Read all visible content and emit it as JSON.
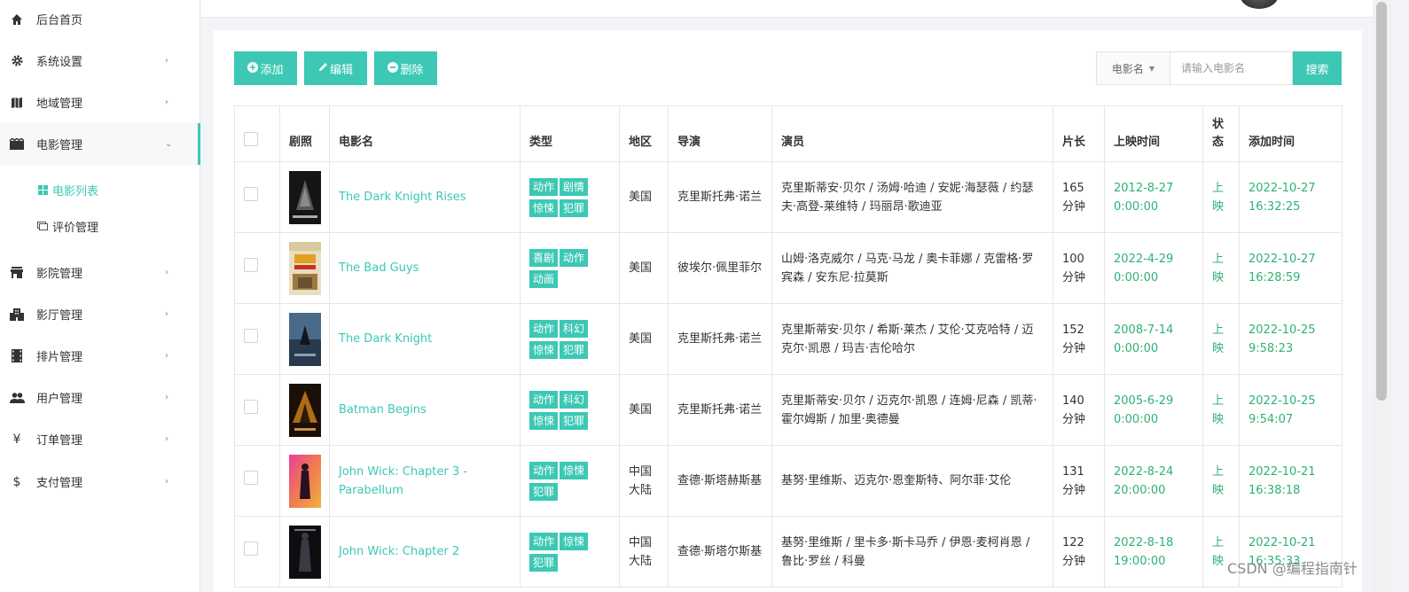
{
  "sidebar": {
    "items": [
      {
        "label": "后台首页",
        "icon": "home-icon"
      },
      {
        "label": "系统设置",
        "icon": "gear-icon"
      },
      {
        "label": "地域管理",
        "icon": "map-icon"
      },
      {
        "label": "电影管理",
        "icon": "film-icon"
      },
      {
        "label": "影院管理",
        "icon": "store-icon"
      },
      {
        "label": "影厅管理",
        "icon": "building-icon"
      },
      {
        "label": "排片管理",
        "icon": "film-strip-icon"
      },
      {
        "label": "用户管理",
        "icon": "users-icon"
      },
      {
        "label": "订单管理",
        "icon": "yen-icon"
      },
      {
        "label": "支付管理",
        "icon": "dollar-icon"
      }
    ],
    "submenu": [
      {
        "label": "电影列表",
        "icon": "grid-icon"
      },
      {
        "label": "评价管理",
        "icon": "comment-icon"
      }
    ]
  },
  "toolbar": {
    "add_label": "添加",
    "edit_label": "编辑",
    "delete_label": "删除"
  },
  "search": {
    "select_label": "电影名",
    "placeholder": "请输入电影名",
    "button_label": "搜索"
  },
  "table": {
    "headers": [
      "剧照",
      "电影名",
      "类型",
      "地区",
      "导演",
      "演员",
      "片长",
      "上映时间",
      "状态",
      "添加时间"
    ],
    "rows": [
      {
        "title": "The Dark Knight Rises",
        "tags": [
          "动作",
          "剧情",
          "惊悚",
          "犯罪"
        ],
        "region": "美国",
        "director": "克里斯托弗·诺兰",
        "cast": "克里斯蒂安·贝尔 / 汤姆·哈迪 / 安妮·海瑟薇 / 约瑟夫·高登-莱维特 / 玛丽昂·歌迪亚",
        "length": "165分钟",
        "release": "2012-8-27 0:00:00",
        "status": "上映",
        "added": "2022-10-27 16:32:25"
      },
      {
        "title": "The Bad Guys",
        "tags": [
          "喜剧",
          "动作",
          "动画"
        ],
        "region": "美国",
        "director": "彼埃尔·佩里菲尔",
        "cast": "山姆·洛克威尔 / 马克·马龙 / 奥卡菲娜 / 克雷格·罗宾森 / 安东尼·拉莫斯",
        "length": "100分钟",
        "release": "2022-4-29 0:00:00",
        "status": "上映",
        "added": "2022-10-27 16:28:59"
      },
      {
        "title": "The Dark Knight",
        "tags": [
          "动作",
          "科幻",
          "惊悚",
          "犯罪"
        ],
        "region": "美国",
        "director": "克里斯托弗·诺兰",
        "cast": "克里斯蒂安·贝尔 / 希斯·莱杰 / 艾伦·艾克哈特 / 迈克尔·凯恩 / 玛吉·吉伦哈尔",
        "length": "152分钟",
        "release": "2008-7-14 0:00:00",
        "status": "上映",
        "added": "2022-10-25 9:58:23"
      },
      {
        "title": "Batman Begins",
        "tags": [
          "动作",
          "科幻",
          "惊悚",
          "犯罪"
        ],
        "region": "美国",
        "director": "克里斯托弗·诺兰",
        "cast": "克里斯蒂安·贝尔 / 迈克尔·凯恩 / 连姆·尼森 / 凯蒂·霍尔姆斯 / 加里·奥德曼",
        "length": "140分钟",
        "release": "2005-6-29 0:00:00",
        "status": "上映",
        "added": "2022-10-25 9:54:07"
      },
      {
        "title": "John Wick: Chapter 3 - Parabellum",
        "tags": [
          "动作",
          "惊悚",
          "犯罪"
        ],
        "region": "中国大陆",
        "director": "查德·斯塔赫斯基",
        "cast": "基努·里维斯、迈克尔·恩奎斯特、阿尔菲·艾伦",
        "length": "131分钟",
        "release": "2022-8-24 20:00:00",
        "status": "上映",
        "added": "2022-10-21 16:38:18"
      },
      {
        "title": "John Wick: Chapter 2",
        "tags": [
          "动作",
          "惊悚",
          "犯罪"
        ],
        "region": "中国大陆",
        "director": "查德·斯塔尔斯基",
        "cast": "基努·里维斯 / 里卡多·斯卡马乔 / 伊恩·麦柯肖恩 / 鲁比·罗丝 / 科曼",
        "length": "122分钟",
        "release": "2022-8-18 19:00:00",
        "status": "上映",
        "added": "2022-10-21 16:35:33"
      }
    ]
  },
  "watermark": "CSDN @编程指南针",
  "colors": {
    "accent": "#3cc8b4",
    "date_green": "#2db373"
  }
}
